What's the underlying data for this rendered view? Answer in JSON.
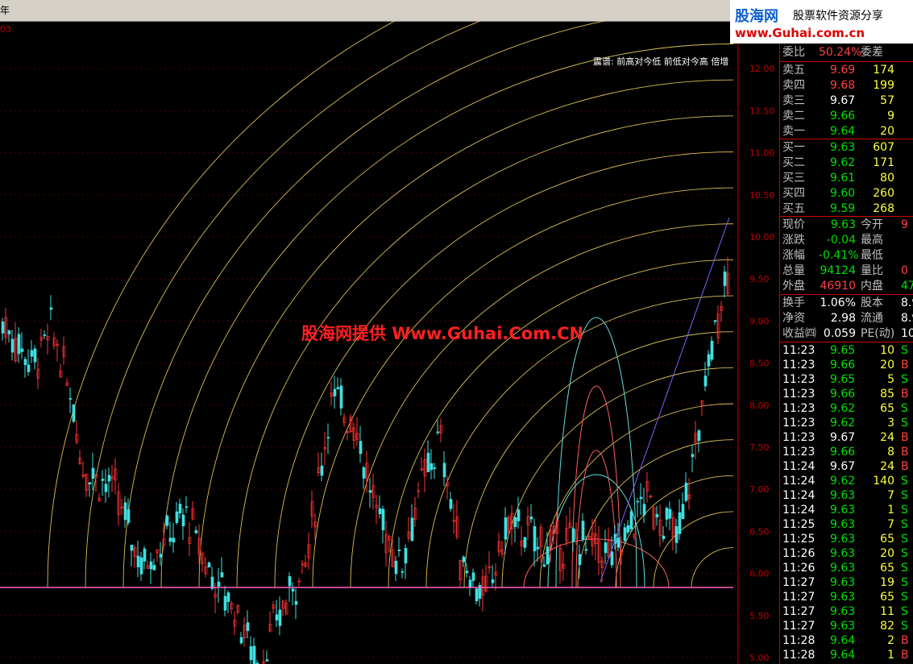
{
  "topbar": {
    "tab_label": "年",
    "left_code": "03"
  },
  "logo": {
    "brand": "股海网",
    "tagline": "股票软件资源分享",
    "url": "www.Guhai.com.cn"
  },
  "chart": {
    "indicator_label": "震谱: 前高对今低 前低对今高 倍增",
    "watermark": "股海网提供 Www.Guhai.Com.CN",
    "price_axis": [
      "12.00",
      "11.50",
      "11.00",
      "10.50",
      "10.00",
      "9.50",
      "9.00",
      "8.50",
      "8.00",
      "7.50",
      "7.00",
      "6.50",
      "6.00",
      "5.50",
      "5.00"
    ],
    "colors": {
      "up": "#ff3333",
      "down": "#40e0e0",
      "arc": "#ffe060",
      "inner_arc": "#ff6060",
      "outer_arc": "#60e0e0",
      "axis": "#c00000"
    }
  },
  "side": {
    "ratio": {
      "label": "委比",
      "value": "50.24%",
      "label2": "委差"
    },
    "asks": [
      {
        "label": "卖五",
        "price": "9.69",
        "vol": "174"
      },
      {
        "label": "卖四",
        "price": "9.68",
        "vol": "199"
      },
      {
        "label": "卖三",
        "price": "9.67",
        "vol": "57"
      },
      {
        "label": "卖二",
        "price": "9.66",
        "vol": "9"
      },
      {
        "label": "卖一",
        "price": "9.64",
        "vol": "20"
      }
    ],
    "bids": [
      {
        "label": "买一",
        "price": "9.63",
        "vol": "607"
      },
      {
        "label": "买二",
        "price": "9.62",
        "vol": "171"
      },
      {
        "label": "买三",
        "price": "9.61",
        "vol": "80"
      },
      {
        "label": "买四",
        "price": "9.60",
        "vol": "260"
      },
      {
        "label": "买五",
        "price": "9.59",
        "vol": "268"
      }
    ],
    "quote": [
      {
        "l1": "现价",
        "v1": "9.63",
        "l2": "今开",
        "v2": "9"
      },
      {
        "l1": "涨跌",
        "v1": "-0.04",
        "l2": "最高",
        "v2": ""
      },
      {
        "l1": "涨幅",
        "v1": "-0.41%",
        "l2": "最低",
        "v2": ""
      },
      {
        "l1": "总量",
        "v1": "94124",
        "l2": "量比",
        "v2": "0"
      },
      {
        "l1": "外盘",
        "v1": "46910",
        "l2": "内盘",
        "v2": "47"
      }
    ],
    "fund": [
      {
        "l1": "换手",
        "v1": "1.06%",
        "l2": "股本",
        "v2": "8.9"
      },
      {
        "l1": "净资",
        "v1": "2.98",
        "l2": "流通",
        "v2": "8.9"
      },
      {
        "l1": "收益㈣",
        "v1": "0.059",
        "l2": "PE(动)",
        "v2": "10"
      }
    ],
    "ticks": [
      {
        "t": "11:23",
        "p": "9.65",
        "v": "10",
        "bs": "S"
      },
      {
        "t": "11:23",
        "p": "9.66",
        "v": "20",
        "bs": "B"
      },
      {
        "t": "11:23",
        "p": "9.65",
        "v": "5",
        "bs": "S"
      },
      {
        "t": "11:23",
        "p": "9.66",
        "v": "85",
        "bs": "B"
      },
      {
        "t": "11:23",
        "p": "9.62",
        "v": "65",
        "bs": "S"
      },
      {
        "t": "11:23",
        "p": "9.62",
        "v": "3",
        "bs": "S"
      },
      {
        "t": "11:23",
        "p": "9.67",
        "v": "24",
        "bs": "B"
      },
      {
        "t": "11:23",
        "p": "9.66",
        "v": "8",
        "bs": "B"
      },
      {
        "t": "11:24",
        "p": "9.67",
        "v": "24",
        "bs": "B"
      },
      {
        "t": "11:24",
        "p": "9.62",
        "v": "140",
        "bs": "S"
      },
      {
        "t": "11:24",
        "p": "9.63",
        "v": "7",
        "bs": "S"
      },
      {
        "t": "11:24",
        "p": "9.63",
        "v": "1",
        "bs": "S"
      },
      {
        "t": "11:25",
        "p": "9.63",
        "v": "7",
        "bs": "S"
      },
      {
        "t": "11:25",
        "p": "9.63",
        "v": "65",
        "bs": "S"
      },
      {
        "t": "11:26",
        "p": "9.63",
        "v": "20",
        "bs": "S"
      },
      {
        "t": "11:26",
        "p": "9.63",
        "v": "65",
        "bs": "S"
      },
      {
        "t": "11:27",
        "p": "9.63",
        "v": "19",
        "bs": "S"
      },
      {
        "t": "11:27",
        "p": "9.63",
        "v": "65",
        "bs": "S"
      },
      {
        "t": "11:27",
        "p": "9.63",
        "v": "11",
        "bs": "S"
      },
      {
        "t": "11:27",
        "p": "9.63",
        "v": "82",
        "bs": "S"
      },
      {
        "t": "11:28",
        "p": "9.64",
        "v": "2",
        "bs": "B"
      },
      {
        "t": "11:28",
        "p": "9.64",
        "v": "1",
        "bs": "B"
      }
    ]
  }
}
